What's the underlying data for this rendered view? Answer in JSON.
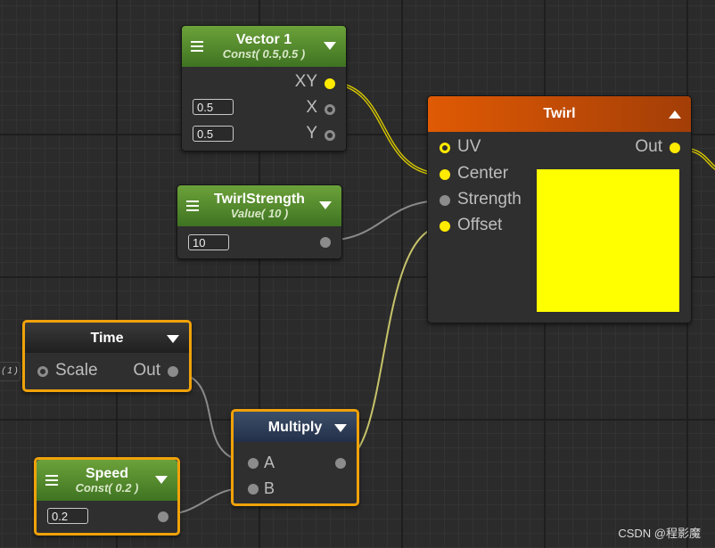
{
  "nodes": {
    "vector1": {
      "title": "Vector 1",
      "subtitle": "Const( 0.5,0.5 )",
      "out_label": "XY",
      "x_label": "X",
      "y_label": "Y",
      "x_value": "0.5",
      "y_value": "0.5"
    },
    "twirl_strength": {
      "title": "TwirlStrength",
      "subtitle": "Value( 10 )",
      "value": "10"
    },
    "time": {
      "title": "Time",
      "in_label": "Scale",
      "out_label": "Out",
      "edge_value": "( 1 )"
    },
    "speed": {
      "title": "Speed",
      "subtitle": "Const( 0.2 )",
      "value": "0.2"
    },
    "multiply": {
      "title": "Multiply",
      "in_a": "A",
      "in_b": "B"
    },
    "twirl": {
      "title": "Twirl",
      "uv": "UV",
      "center": "Center",
      "strength": "Strength",
      "offset": "Offset",
      "out_label": "Out",
      "preview_color": "#ffff00"
    }
  },
  "colors": {
    "accent_selected": "#f0a20a",
    "port_active": "#ffea00",
    "port_inactive": "#8c8c8c",
    "header_green": "#5a8f2e",
    "header_orange": "#e05a04"
  },
  "watermark": "CSDN @程影魔"
}
